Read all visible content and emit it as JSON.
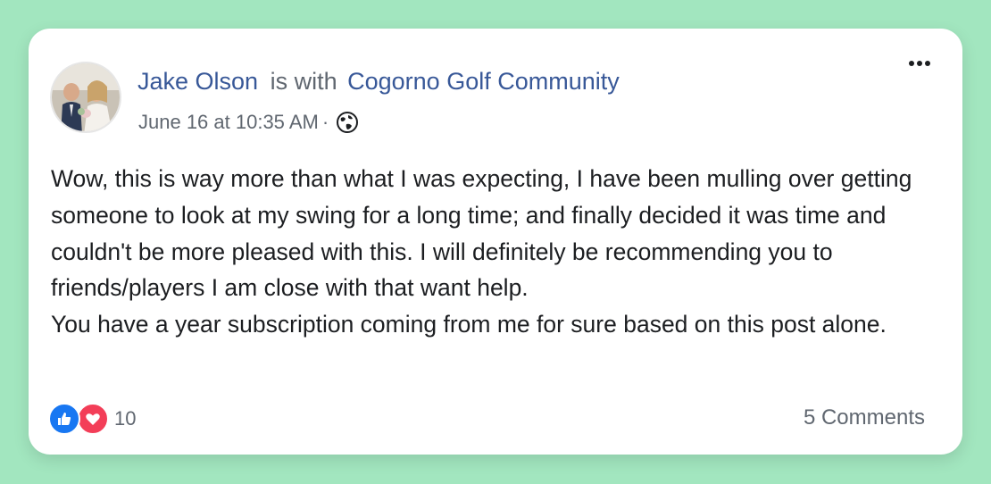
{
  "post": {
    "author": "Jake Olson",
    "with_text": "is with",
    "group": "Cogorno Golf Community",
    "timestamp": "June 16 at 10:35 AM",
    "meta_separator": "·",
    "body": "Wow, this is way more than what I was expecting, I have been mulling over getting someone to look at my swing for a long time; and finally decided it was time and couldn't be more pleased with this. I will definitely be recommending you to friends/players I am close with that want help.\nYou have a year subscription coming from me for sure based on this post alone.",
    "reaction_count": "10",
    "comments": "5 Comments",
    "icons": {
      "privacy": "globe-icon",
      "menu": "more-options-icon",
      "reactions": [
        "like-icon",
        "love-icon"
      ]
    }
  },
  "colors": {
    "background": "#a2e6bf",
    "link": "#385898",
    "like": "#1877f2",
    "love": "#f33e58"
  }
}
